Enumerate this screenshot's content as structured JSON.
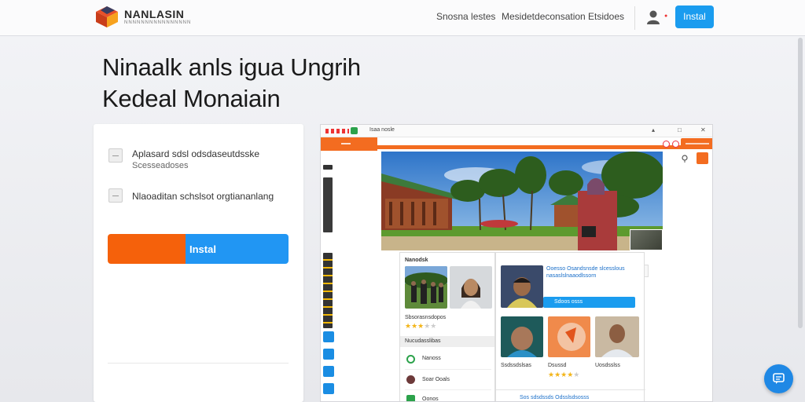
{
  "header": {
    "brand": "NANLASIN",
    "brand_sub": "NNNNNNNNNNNNNNNN",
    "nav": [
      "Snosna lestes",
      "Mesidetdeconsation",
      "Etsidoes"
    ],
    "cta": "Instal"
  },
  "hero": {
    "line1": "Ninaalk anls igua Ungrih",
    "line2": "Kedeal Monaiain"
  },
  "card": {
    "option1_label": "Aplasard sdsl odsdaseutdsske",
    "option1_sub": "Scesseadoses",
    "option2_label": "Nlaoaditan schslsot orgtiananlang",
    "install_label": "Instal"
  },
  "window": {
    "title": "Isaa nosle",
    "panel_title": "Nanodsk",
    "panel_rating": 3.5,
    "panel_caption": "Sbsorasnsdopos",
    "panel_section": "Nucudasslibas",
    "list": [
      "Nanoss",
      "Soar Ooals",
      "Oonos"
    ],
    "card_text": "Ooesso Osandsnsde slcesslous nasaslslnaaodlssorn",
    "card_button": "Sdoos osss",
    "gallery_captions": [
      "Ssdssdslsas",
      "Dsussd",
      "Uosdsslss"
    ],
    "gallery_rating": 4.5,
    "footer_link": "Sos sdsdssds Odsslsdsosss"
  },
  "colors": {
    "accent_orange": "#f5610b",
    "accent_blue": "#1a9cef"
  },
  "icons": [
    "logo-cube-icon",
    "user-icon",
    "chat-icon",
    "location-pin-icon"
  ]
}
